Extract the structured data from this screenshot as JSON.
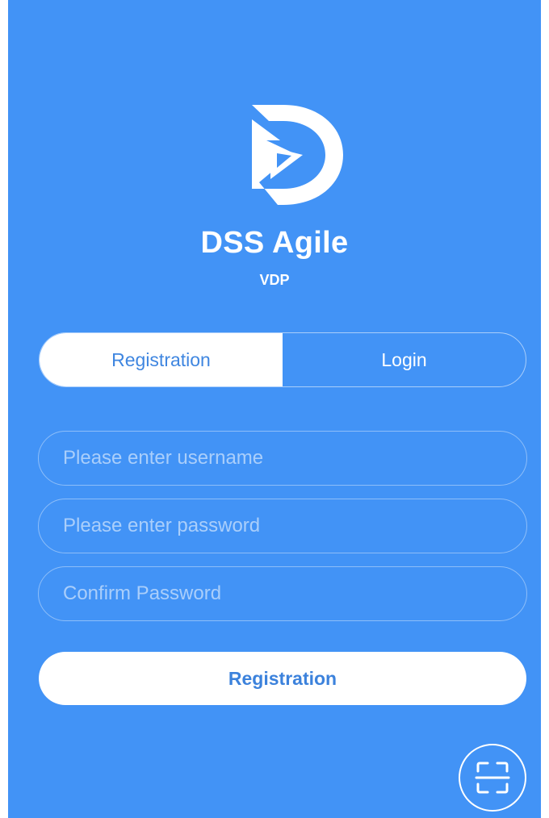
{
  "app": {
    "title": "DSS Agile",
    "subtitle": "VDP"
  },
  "tabs": [
    {
      "label": "Registration",
      "active": true
    },
    {
      "label": "Login",
      "active": false
    }
  ],
  "form": {
    "username_placeholder": "Please enter username",
    "password_placeholder": "Please enter password",
    "confirm_placeholder": "Confirm Password",
    "submit_label": "Registration"
  },
  "icons": {
    "logo": "dss-logo-icon",
    "scan": "scan-qr-icon"
  },
  "colors": {
    "background": "#4293f6",
    "accent": "#3f86e0",
    "white": "#ffffff"
  }
}
